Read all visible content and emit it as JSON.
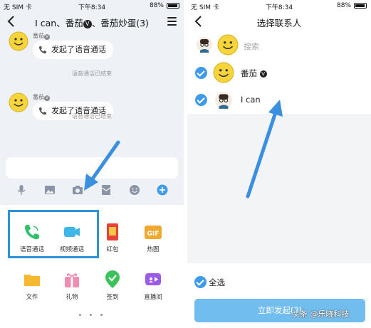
{
  "status_bar": {
    "carrier": "无 SIM 卡",
    "time": "下午8:34",
    "battery": "88%"
  },
  "chat": {
    "title": "I can、番茄",
    "title_suffix": "、番茄炒蛋(3)",
    "badge": "V",
    "messages": [
      {
        "sender": "番茄",
        "badge": "V",
        "text": "发起了语音通话",
        "status": "语音通话已结束"
      },
      {
        "sender": "番茄",
        "badge": "V",
        "text": "发起了语音通话",
        "status": "语音通话已结束"
      }
    ],
    "input_placeholder": "",
    "tools": [
      "microphone-icon",
      "image-icon",
      "camera-icon",
      "red-envelope-icon",
      "emoji-icon",
      "plus-icon"
    ],
    "panel_items": [
      {
        "label": "语音通话",
        "icon": "voice-call-icon",
        "color": "#33c26b"
      },
      {
        "label": "视频通话",
        "icon": "video-call-icon",
        "color": "#3fb6e8"
      },
      {
        "label": "红包",
        "icon": "red-packet-icon",
        "color": "#e8413a"
      },
      {
        "label": "热图",
        "icon": "gif-icon",
        "color": "#f0a92e"
      },
      {
        "label": "文件",
        "icon": "folder-icon",
        "color": "#f5b82e"
      },
      {
        "label": "礼物",
        "icon": "gift-icon",
        "color": "#f28bb0"
      },
      {
        "label": "签到",
        "icon": "checkin-icon",
        "color": "#3cc25b"
      },
      {
        "label": "直播间",
        "icon": "live-room-icon",
        "color": "#9b5be8"
      }
    ],
    "page_dots": "• • •"
  },
  "contacts": {
    "title": "选择联系人",
    "search_placeholder": "搜索",
    "rows": [
      {
        "name": "番茄",
        "badge": "V",
        "checked": true
      },
      {
        "name": "I can",
        "checked": true
      }
    ],
    "select_all": "全选",
    "start_button": "立即发起(3)"
  },
  "watermark": "头条 @乐晓科技",
  "colors": {
    "accent": "#3d9be9",
    "highlight_border": "#2f91d8",
    "arrow": "#3a8fe0"
  }
}
